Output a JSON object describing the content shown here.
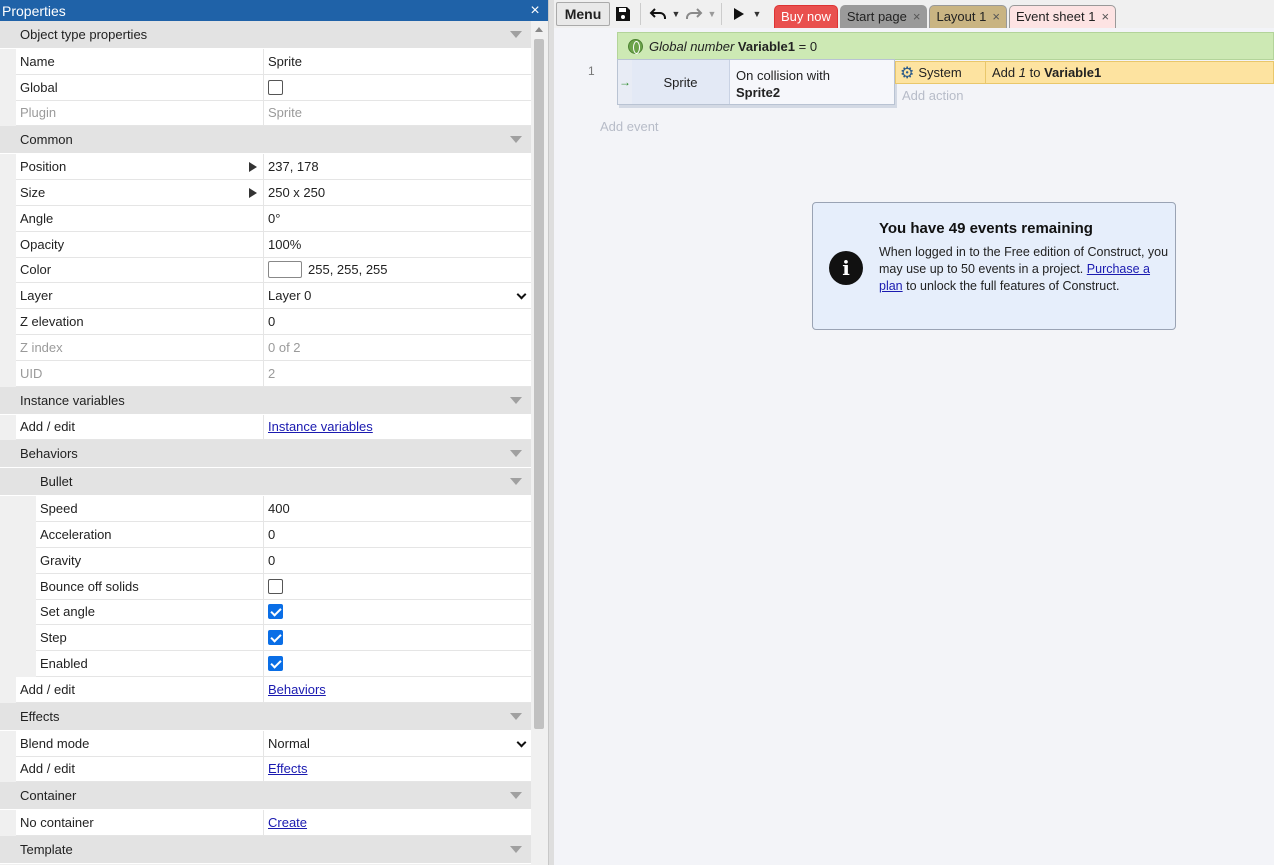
{
  "properties": {
    "title": "Properties",
    "close_icon": "×",
    "sections": {
      "object_type": "Object type properties",
      "common": "Common",
      "instance_vars": "Instance variables",
      "behaviors": "Behaviors",
      "bullet": "Bullet",
      "effects": "Effects",
      "container": "Container",
      "template": "Template"
    },
    "name": {
      "label": "Name",
      "value": "Sprite"
    },
    "global": {
      "label": "Global",
      "checked": false
    },
    "plugin": {
      "label": "Plugin",
      "value": "Sprite"
    },
    "position": {
      "label": "Position",
      "value": "237, 178"
    },
    "size": {
      "label": "Size",
      "value": "250 x 250"
    },
    "angle": {
      "label": "Angle",
      "value": "0°"
    },
    "opacity": {
      "label": "Opacity",
      "value": "100%"
    },
    "color": {
      "label": "Color",
      "value": "255, 255, 255",
      "swatch": "#ffffff"
    },
    "layer": {
      "label": "Layer",
      "value": "Layer 0"
    },
    "z_elevation": {
      "label": "Z elevation",
      "value": "0"
    },
    "z_index": {
      "label": "Z index",
      "value": "0 of 2"
    },
    "uid": {
      "label": "UID",
      "value": "2"
    },
    "inst_add_edit": {
      "label": "Add / edit",
      "link": "Instance variables"
    },
    "speed": {
      "label": "Speed",
      "value": "400"
    },
    "acceleration": {
      "label": "Acceleration",
      "value": "0"
    },
    "gravity": {
      "label": "Gravity",
      "value": "0"
    },
    "bounce": {
      "label": "Bounce off solids",
      "checked": false
    },
    "set_angle": {
      "label": "Set angle",
      "checked": true
    },
    "step": {
      "label": "Step",
      "checked": true
    },
    "enabled": {
      "label": "Enabled",
      "checked": true
    },
    "beh_add_edit": {
      "label": "Add / edit",
      "link": "Behaviors"
    },
    "blend_mode": {
      "label": "Blend mode",
      "value": "Normal"
    },
    "fx_add_edit": {
      "label": "Add / edit",
      "link": "Effects"
    },
    "no_container": {
      "label": "No container",
      "link": "Create"
    }
  },
  "toolbar": {
    "menu_label": "Menu",
    "tabs": [
      {
        "label": "Buy now"
      },
      {
        "label": "Start page"
      },
      {
        "label": "Layout 1"
      },
      {
        "label": "Event sheet 1"
      }
    ]
  },
  "events": {
    "global_var": {
      "prefix": "Global number",
      "name": "Variable1",
      "suffix": "= 0"
    },
    "event_number": "1",
    "condition_object": "Sprite",
    "condition_text": "On collision with",
    "condition_target": "Sprite2",
    "action_object": "System",
    "action_text_prefix": "Add",
    "action_value": "1",
    "action_text_mid": "to",
    "action_target": "Variable1",
    "add_action": "Add action",
    "add_event": "Add event"
  },
  "notice": {
    "title": "You have 49 events remaining",
    "body_1": "When logged in to the Free edition of Construct, you may use up to 50 events in a project.",
    "link": "Purchase a plan",
    "body_2": "to unlock the full features of Construct."
  }
}
